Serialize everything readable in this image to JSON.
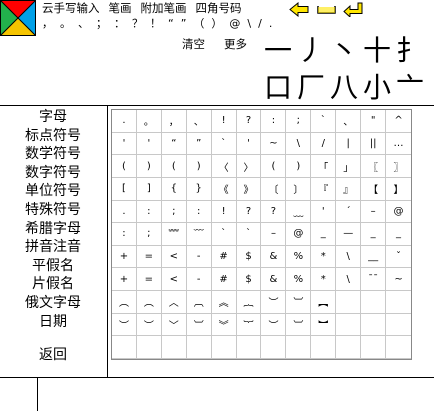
{
  "menu": [
    {
      "name": "menu-cloud-handwriting",
      "label": "云手写输入"
    },
    {
      "name": "menu-strokes",
      "label": "笔画"
    },
    {
      "name": "menu-extra-strokes",
      "label": "附加笔画"
    },
    {
      "name": "menu-four-corner",
      "label": "四角号码"
    }
  ],
  "punctuation": [
    "，",
    "。",
    "、",
    "；",
    "：",
    "？",
    "！",
    "“",
    "”",
    "（",
    "）",
    "@",
    "\\",
    "/",
    "."
  ],
  "actions": {
    "clear": "清空",
    "more": "更多"
  },
  "recent_chars": [
    [
      "一",
      "丿",
      "丶",
      "十",
      "扌"
    ],
    [
      "口",
      "厂",
      "八",
      "小",
      "亠"
    ]
  ],
  "categories": [
    "字母",
    "标点符号",
    "数学符号",
    "数字符号",
    "单位符号",
    "特殊符号",
    "希腊字母",
    "拼音注音",
    "平假名",
    "片假名",
    "俄文字母",
    "日期"
  ],
  "back_label": "返回",
  "grid_rows": [
    [
      ".",
      "。",
      "，",
      "、",
      "!",
      "?",
      ":",
      ";",
      "`",
      "、",
      "\"",
      "^"
    ],
    [
      "'",
      "'",
      "“",
      "”",
      "`",
      "'",
      "~",
      "\\",
      "/",
      "|",
      "||",
      "…"
    ],
    [
      "(",
      ")",
      "(",
      ")",
      "〈",
      "〉",
      "(",
      ")",
      "「",
      "」",
      "〖",
      "〗"
    ],
    [
      "[",
      "]",
      "{",
      "}",
      "《",
      "》",
      "〔",
      "〕",
      "『",
      "』",
      "【",
      "】"
    ],
    [
      ".",
      ":",
      ";",
      ":",
      "!",
      "?",
      "?",
      "﹏",
      "'",
      "´",
      "–",
      "@",
      "|"
    ],
    [
      ":",
      ";",
      "﹌",
      "﹋",
      "ˋ",
      "`",
      "–",
      "@",
      "_",
      "—",
      "_",
      "_"
    ],
    [
      "+",
      "=",
      "<",
      "-",
      "#",
      "$",
      "&",
      "%",
      "*",
      "\\",
      "__",
      "ˇ"
    ],
    [
      "+",
      "=",
      "<",
      "-",
      "#",
      "$",
      "&",
      "%",
      "*",
      "\\",
      "¯¯",
      "~"
    ],
    [
      "︵",
      "︵",
      "︿",
      "︹",
      "︽",
      "︷",
      "︶",
      "︺",
      "︻",
      "",
      "",
      ""
    ],
    [
      "︶",
      "︶",
      "﹀",
      "︺",
      "︾",
      "︸",
      "︶",
      "︺",
      "︼",
      "",
      "",
      ""
    ],
    [
      "",
      "",
      "",
      "",
      "",
      "",
      "",
      "",
      "",
      "",
      "",
      ""
    ]
  ]
}
